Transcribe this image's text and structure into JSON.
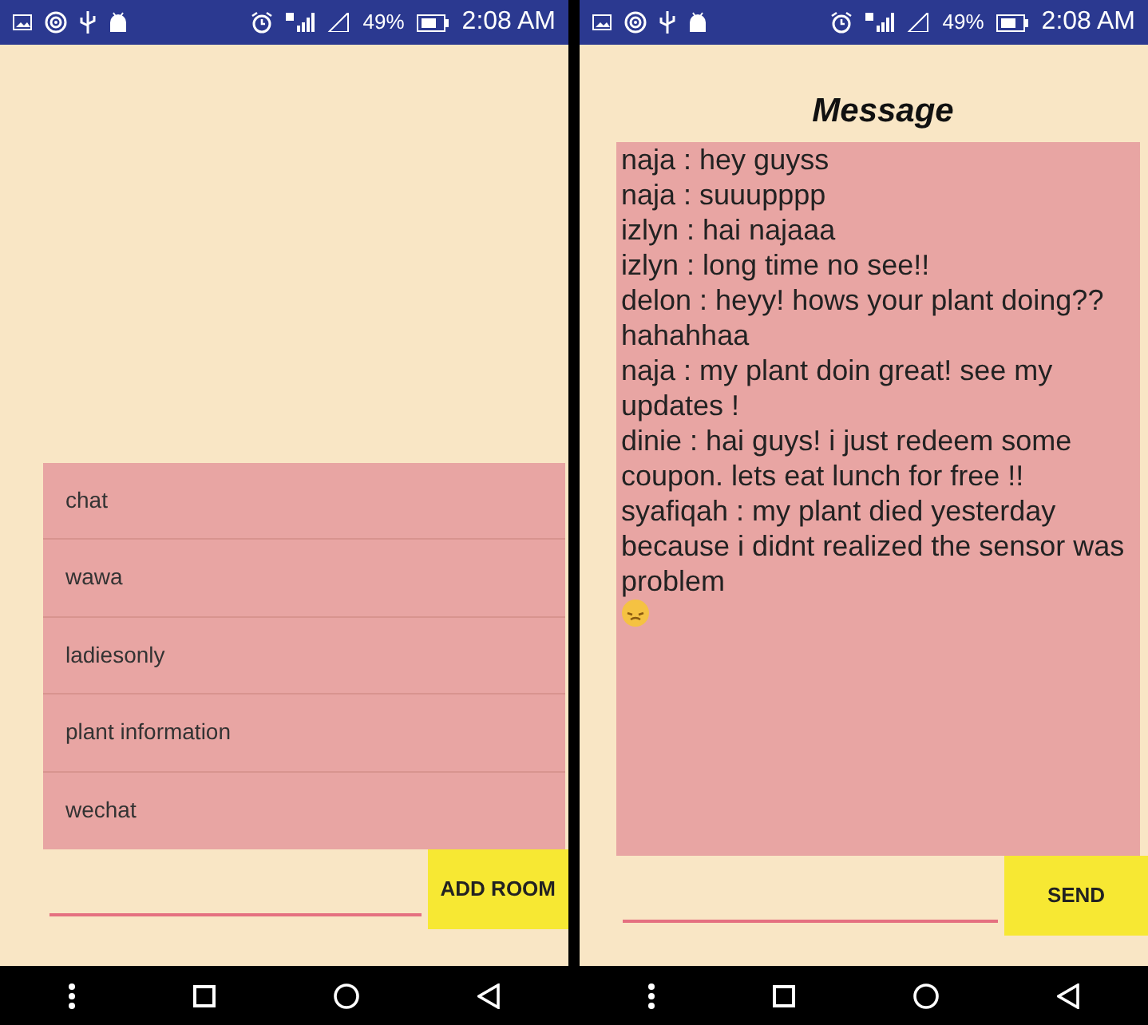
{
  "screens": [
    {
      "kind": "rooms",
      "status_bar": {
        "battery": "49%",
        "time": "2:08 AM"
      },
      "rooms": [
        {
          "name": "chat"
        },
        {
          "name": "wawa"
        },
        {
          "name": "ladiesonly"
        },
        {
          "name": "plant information"
        },
        {
          "name": "wechat"
        }
      ],
      "add_button": "ADD ROOM"
    },
    {
      "kind": "chat",
      "status_bar": {
        "battery": "49%",
        "time": "2:08 AM"
      },
      "title": "Message",
      "messages": [
        {
          "text": "naja : hey guyss",
          "emoji": false
        },
        {
          "text": "naja : suuupppp",
          "emoji": false
        },
        {
          "text": "izlyn : hai najaaa",
          "emoji": false
        },
        {
          "text": "izlyn : long time no see!!",
          "emoji": false
        },
        {
          "text": "delon : heyy! hows your plant doing?? hahahhaa",
          "emoji": false
        },
        {
          "text": "naja : my plant doin great! see my updates !",
          "emoji": false
        },
        {
          "text": "dinie : hai guys! i just redeem some coupon. lets eat lunch for free !!",
          "emoji": false
        },
        {
          "text": "syafiqah : my plant died yesterday because i didnt realized the sensor was problem",
          "emoji": true
        }
      ],
      "send_button": "SEND"
    }
  ]
}
